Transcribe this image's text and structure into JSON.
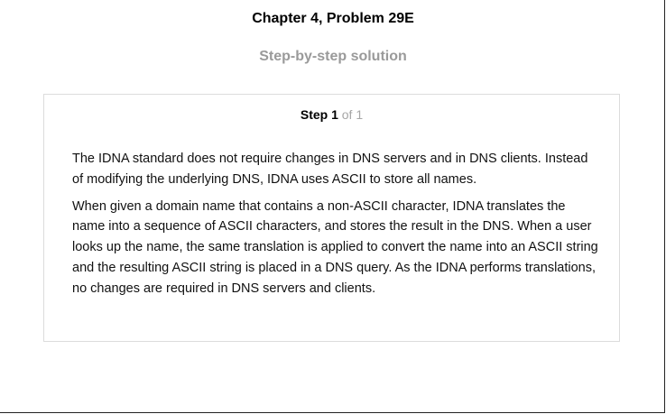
{
  "header": {
    "title": "Chapter 4, Problem 29E",
    "subtitle": "Step-by-step solution"
  },
  "step": {
    "label": "Step 1",
    "of": "of 1"
  },
  "paragraphs": [
    "The IDNA standard does not require changes in DNS servers and in DNS clients. Instead of modifying the underlying DNS, IDNA uses ASCII to store all names.",
    "When given a domain name that contains a non-ASCII character, IDNA translates the name into a sequence of ASCII characters, and stores the result in the DNS. When a user looks up the name, the same translation is applied to convert the name into an ASCII string and the resulting ASCII string is placed in a DNS query. As the IDNA performs translations, no changes are required in DNS servers and clients."
  ]
}
